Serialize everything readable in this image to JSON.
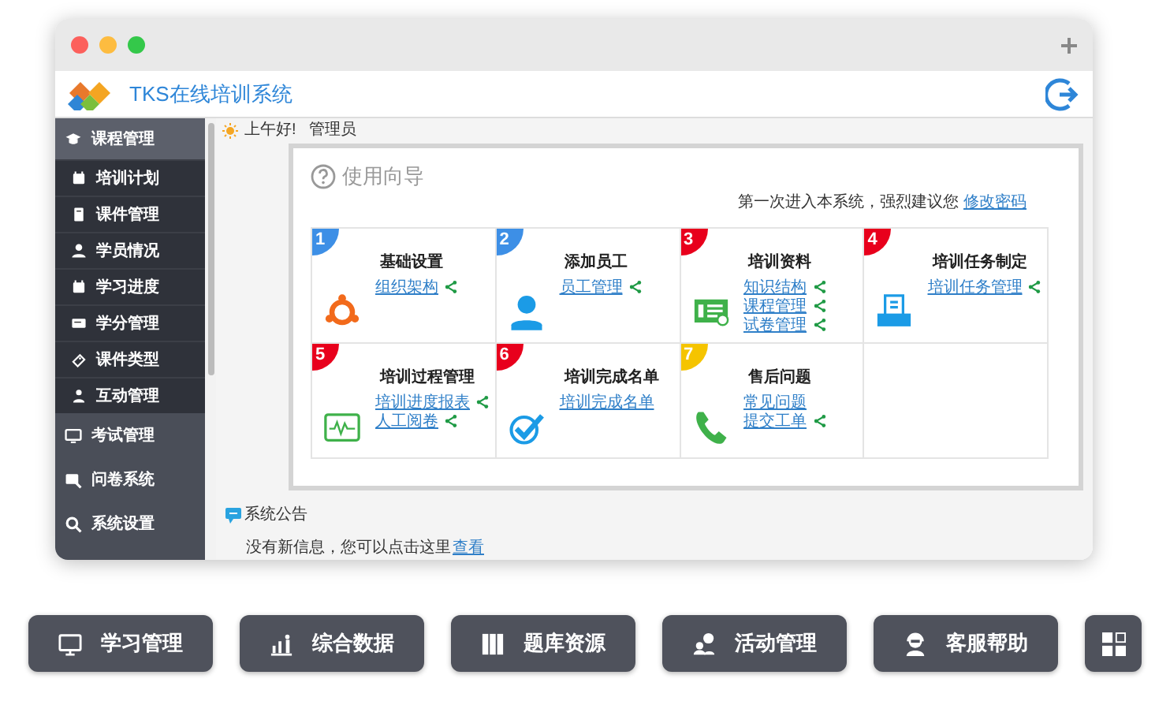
{
  "app": {
    "title": "TKS在线培训系统"
  },
  "sidebar": {
    "items": [
      {
        "label": "课程管理",
        "expanded": true,
        "children": [
          {
            "label": "培训计划"
          },
          {
            "label": "课件管理"
          },
          {
            "label": "学员情况"
          },
          {
            "label": "学习进度"
          },
          {
            "label": "学分管理"
          },
          {
            "label": "课件类型"
          },
          {
            "label": "互动管理"
          }
        ]
      },
      {
        "label": "考试管理",
        "expanded": false
      },
      {
        "label": "问卷系统",
        "expanded": false
      },
      {
        "label": "系统设置",
        "expanded": false
      }
    ]
  },
  "greeting": {
    "text": "上午好!",
    "user": "管理员"
  },
  "guide": {
    "title": "使用向导",
    "notice": {
      "text": "第一次进入本系统，强烈建议您",
      "link": "修改密码"
    },
    "steps": [
      {
        "number": "1",
        "color": "#3d8fe6",
        "title": "基础设置",
        "links": [
          {
            "label": "组织架构",
            "share": true
          }
        ]
      },
      {
        "number": "2",
        "color": "#3d8fe6",
        "title": "添加员工",
        "links": [
          {
            "label": "员工管理",
            "share": true
          }
        ]
      },
      {
        "number": "3",
        "color": "#e8001c",
        "title": "培训资料",
        "links": [
          {
            "label": "知识结构",
            "share": true
          },
          {
            "label": "课程管理",
            "share": true
          },
          {
            "label": "试卷管理",
            "share": true
          }
        ]
      },
      {
        "number": "4",
        "color": "#e8001c",
        "title": "培训任务制定",
        "links": [
          {
            "label": "培训任务管理",
            "share": true
          }
        ]
      },
      {
        "number": "5",
        "color": "#e8001c",
        "title": "培训过程管理",
        "links": [
          {
            "label": "培训进度报表",
            "share": true
          },
          {
            "label": "人工阅卷",
            "share": true
          }
        ]
      },
      {
        "number": "6",
        "color": "#e8001c",
        "title": "培训完成名单",
        "links": [
          {
            "label": "培训完成名单",
            "share": false
          }
        ]
      },
      {
        "number": "7",
        "color": "#f5c400",
        "title": "售后问题",
        "links": [
          {
            "label": "常见问题",
            "share": false
          },
          {
            "label": "提交工单",
            "share": true
          }
        ]
      }
    ]
  },
  "announcement": {
    "title": "系统公告",
    "message": "没有新信息，您可以点击这里",
    "link": "查看"
  },
  "bottom_buttons": [
    {
      "label": "学习管理"
    },
    {
      "label": "综合数据"
    },
    {
      "label": "题库资源"
    },
    {
      "label": "活动管理"
    },
    {
      "label": "客服帮助"
    }
  ]
}
